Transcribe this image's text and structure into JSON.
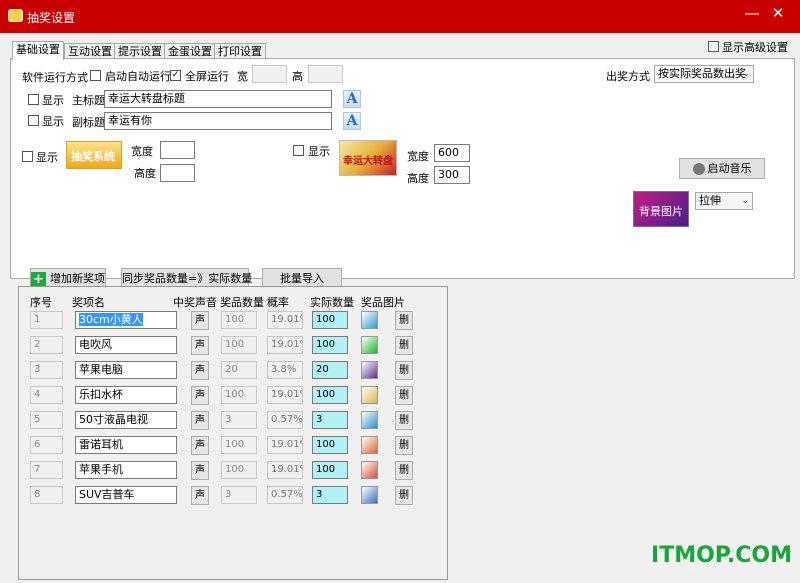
{
  "window": {
    "title": "抽奖设置",
    "minimize": "—",
    "close": "✕"
  },
  "tabs": [
    "基础设置",
    "互动设置",
    "提示设置",
    "金蛋设置",
    "打印设置"
  ],
  "advanced_label": "显示高级设置",
  "run_mode": {
    "label": "软件运行方式",
    "autostart_label": "启动自动运行",
    "fullscreen_label": "全屏运行",
    "width_label": "宽",
    "height_label": "高",
    "width_value": "",
    "height_value": ""
  },
  "draw_mode": {
    "label": "出奖方式",
    "value": "按实际奖品数出奖"
  },
  "titles": {
    "show_label": "显示",
    "main_label": "主标题",
    "main_value": "幸运大转盘标题",
    "sub_label": "副标题",
    "sub_value": "幸运有你",
    "font_button": "A"
  },
  "images": {
    "show_label": "显示",
    "width_label": "宽度",
    "height_label": "高度",
    "logo_width": "",
    "logo_height": "",
    "banner_width": "600",
    "banner_height": "300",
    "logo_text": "抽奖系统",
    "banner_text": "幸运大转盘"
  },
  "music_button": "启动音乐",
  "background": {
    "text": "背景图片",
    "stretch_value": "拉伸"
  },
  "prize_toolbar": {
    "add": "增加新奖项",
    "sync": "同步奖品数量=》实际数量",
    "import": "批量导入"
  },
  "prize_table": {
    "headers": [
      "序号",
      "奖项名",
      "中奖声音",
      "奖品数量",
      "概率",
      "实际数量",
      "奖品图片"
    ],
    "sound_label": "声",
    "delete_label": "删",
    "rows": [
      {
        "idx": "1",
        "name": "30cm小黄人",
        "qty": "100",
        "prob": "19.01%",
        "actual": "100",
        "img_color": "#2b9bd1"
      },
      {
        "idx": "2",
        "name": "电吹风",
        "qty": "100",
        "prob": "19.01%",
        "actual": "100",
        "img_color": "#1bb82b"
      },
      {
        "idx": "3",
        "name": "苹果电脑",
        "qty": "20",
        "prob": "3.8%",
        "actual": "20",
        "img_color": "#5a2e8f"
      },
      {
        "idx": "4",
        "name": "乐扣水杯",
        "qty": "100",
        "prob": "19.01%",
        "actual": "100",
        "img_color": "#d9b84a"
      },
      {
        "idx": "5",
        "name": "50寸液晶电视",
        "qty": "3",
        "prob": "0.57%",
        "actual": "3",
        "img_color": "#2a8fc9"
      },
      {
        "idx": "6",
        "name": "雷诺耳机",
        "qty": "100",
        "prob": "19.01%",
        "actual": "100",
        "img_color": "#e0632a"
      },
      {
        "idx": "7",
        "name": "苹果手机",
        "qty": "100",
        "prob": "19.01%",
        "actual": "100",
        "img_color": "#d94a3a"
      },
      {
        "idx": "8",
        "name": "SUV吉普车",
        "qty": "3",
        "prob": "0.57%",
        "actual": "3",
        "img_color": "#3a6fbf"
      }
    ]
  },
  "watermark": "ITMOP.COM"
}
